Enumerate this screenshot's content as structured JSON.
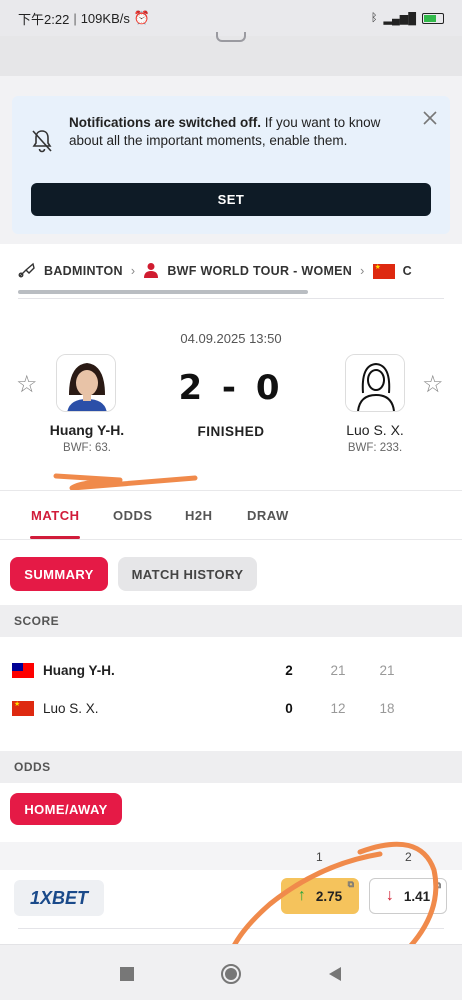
{
  "status_bar": {
    "time": "下午2:22",
    "speed": "109KB/s",
    "icons": [
      "alarm-icon",
      "bluetooth-icon",
      "signal-icon",
      "wifi-icon",
      "battery-icon"
    ]
  },
  "notification": {
    "title": "Notifications are switched off.",
    "body": " If you want to know about all the important moments, enable them.",
    "button": "SET"
  },
  "breadcrumb": {
    "sport": "BADMINTON",
    "tournament": "BWF WORLD TOUR - WOMEN",
    "country_partial": "C"
  },
  "match": {
    "datetime": "04.09.2025 13:50",
    "score": "2 - 0",
    "status": "FINISHED",
    "home": {
      "name": "Huang Y-H.",
      "rank": "BWF: 63."
    },
    "away": {
      "name": "Luo S. X.",
      "rank": "BWF: 233."
    }
  },
  "tabs": [
    "MATCH",
    "ODDS",
    "H2H",
    "DRAW"
  ],
  "subtabs": {
    "summary": "SUMMARY",
    "history": "MATCH HISTORY"
  },
  "score_section": {
    "header": "SCORE",
    "rows": [
      {
        "name": "Huang Y-H.",
        "total": "2",
        "set1": "21",
        "set2": "21"
      },
      {
        "name": "Luo S. X.",
        "total": "0",
        "set1": "12",
        "set2": "18"
      }
    ]
  },
  "odds_section": {
    "header": "ODDS",
    "filter": "HOME/AWAY",
    "col1": "1",
    "col2": "2",
    "bookmaker": "1XBET",
    "odd1": "2.75",
    "odd2": "1.41"
  },
  "colors": {
    "accent": "#e51a46",
    "dark": "#0e1b26",
    "annotation": "#f08a4b"
  }
}
